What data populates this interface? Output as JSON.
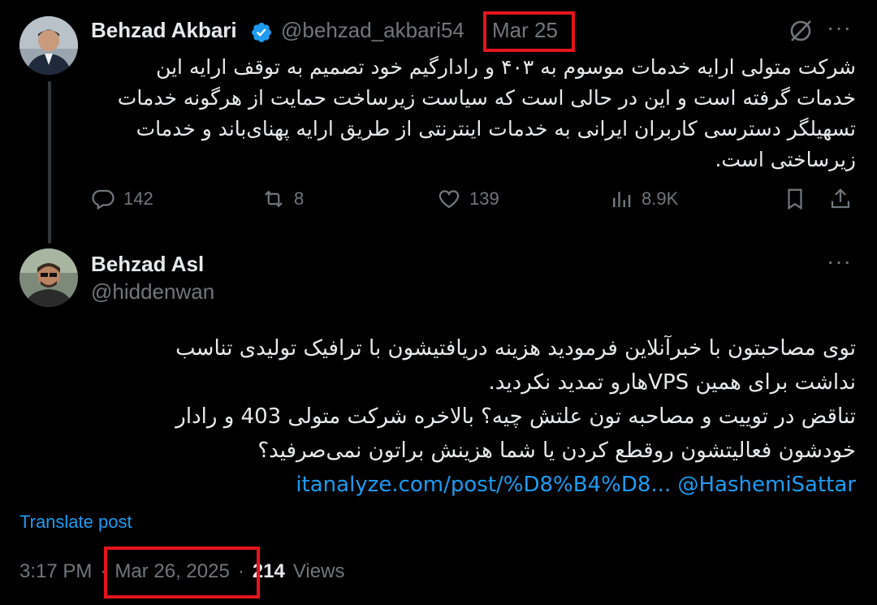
{
  "tweet1": {
    "author_name": "Behzad Akbari",
    "handle": "@behzad_akbari54",
    "separator": "·",
    "date": "Mar 25",
    "body": "شرکت متولی ارایه خدمات موسوم به ۴۰۳ و رادارگیم خود تصمیم به توقف ارایه این خدمات گرفته است و این در حالی است که سیاست زیرساخت حمایت از هرگونه خدمات تسهیلگر دسترسی کاربران ایرانی به خدمات اینترنتی از طریق ارایه پهنای‌باند و خدمات زیرساختی است.",
    "replies": "142",
    "reposts": "8",
    "likes": "139",
    "views": "8.9K"
  },
  "tweet2": {
    "author_name": "Behzad Asl",
    "handle": "@hiddenwan",
    "body_line1": "توی مصاحبتون با خبرآنلاین فرمودید هزینه دریافتیشون با ترافیک تولیدی تناسب",
    "body_line2": "نداشت برای همین VPSهارو تمدید نکردید.",
    "body_line3": "تناقض در توییت و مصاحبه تون علتش چیه؟ بالاخره شرکت متولی 403 و رادار",
    "body_line4": "خودشون فعالیتشون روقطع کردن یا شما هزینش براتون نمی‌صرفید؟",
    "link_text": "itanalyze.com/post/%D8%B4%D8...",
    "mention": "@HashemiSattar",
    "translate": "Translate post",
    "time": "3:17 PM",
    "separator": "·",
    "date": "Mar 26, 2025",
    "views_count": "214",
    "views_label": "Views"
  },
  "colors": {
    "background": "#000000",
    "text": "#e7e9ea",
    "muted": "#71767b",
    "link": "#1d9bf0",
    "verified": "#1d9bf0",
    "highlight": "#e3151b"
  }
}
